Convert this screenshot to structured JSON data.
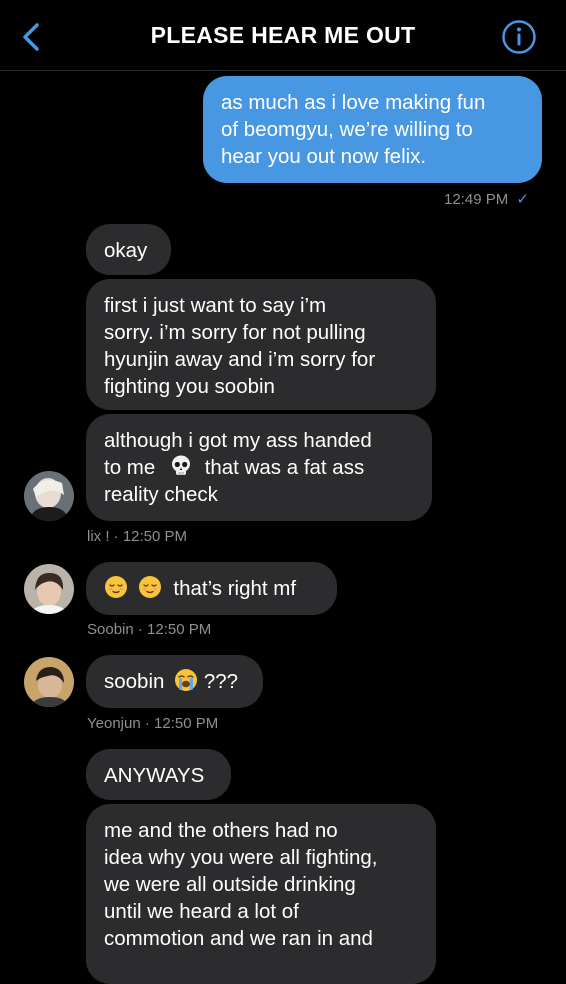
{
  "header": {
    "title": "PLEASE HEAR ME OUT"
  },
  "colors": {
    "accent": "#4797e3",
    "incoming_bubble": "#2c2c2e",
    "meta_text": "#8e8e93"
  },
  "messages": {
    "m1": {
      "text": "as much as i love making fun\nof beomgyu, we’re willing to\nhear you out now felix.",
      "time": "12:49 PM",
      "status": "✓"
    },
    "m2": {
      "text": "okay"
    },
    "m3": {
      "text": "first i just want to say i’m\nsorry. i’m sorry for not pulling\nhyunjin away and i’m sorry for\nfighting you soobin"
    },
    "m4": {
      "line1": "although i got my ass handed",
      "line2a": "to me",
      "line2b": "that was a fat ass",
      "line3": "reality check"
    },
    "sender1": "lix ! · 12:50 PM",
    "m5": {
      "text": "that’s right mf"
    },
    "sender2": "Soobin · 12:50 PM",
    "m6": {
      "a": "soobin",
      "b": "???"
    },
    "sender3": "Yeonjun · 12:50 PM",
    "m7": {
      "text": "ANYWAYS"
    },
    "m8": {
      "text": "me and the others had no\nidea why you were all fighting,\nwe were all outside drinking\nuntil we heard a lot of\ncommotion and we ran in and"
    }
  },
  "icons": {
    "back": "chevron-left-icon",
    "info": "info-circle-icon",
    "skull": "skull-emoji",
    "relieved": "relieved-face-emoji",
    "crying": "loudly-crying-face-emoji"
  }
}
